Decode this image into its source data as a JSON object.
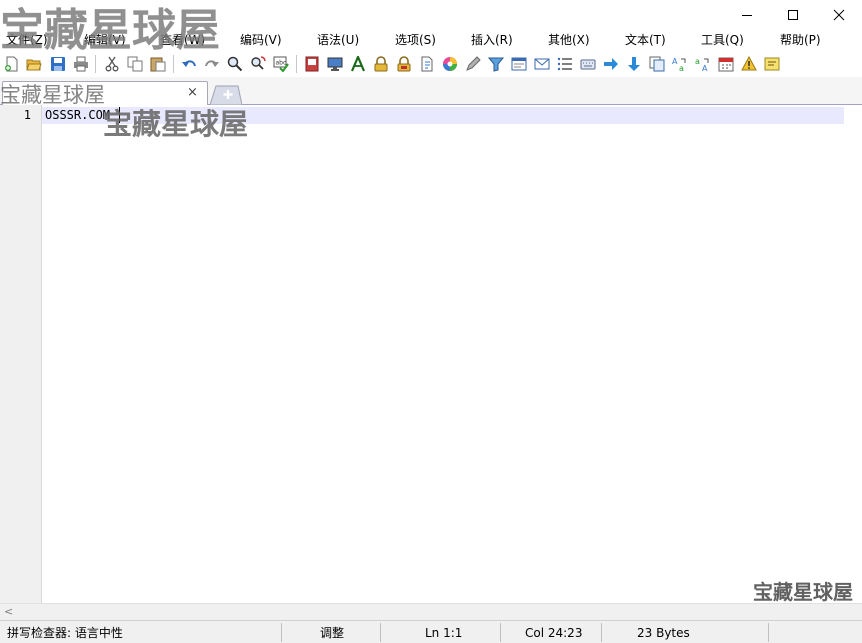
{
  "window": {
    "controls": [
      "minimize-icon",
      "maximize-icon",
      "close-icon"
    ]
  },
  "menu": {
    "items": [
      {
        "label": "文件(Z)"
      },
      {
        "label": "编辑(V)"
      },
      {
        "label": "查看(W)"
      },
      {
        "label": "编码(V)"
      },
      {
        "label": "语法(U)"
      },
      {
        "label": "选项(S)"
      },
      {
        "label": "插入(R)"
      },
      {
        "label": "其他(X)"
      },
      {
        "label": "文本(T)"
      },
      {
        "label": "工具(Q)"
      },
      {
        "label": "帮助(P)"
      }
    ]
  },
  "toolbar": {
    "icons": [
      "new-file-icon",
      "open-folder-icon",
      "save-icon",
      "print-icon",
      "cut-icon",
      "copy-icon",
      "paste-icon",
      "undo-icon",
      "redo-icon",
      "find-icon",
      "replace-icon",
      "spellcheck-icon",
      "book-icon",
      "monitor-icon",
      "font-icon",
      "lock-icon",
      "lock-read-only-icon",
      "document-export-icon",
      "color-wheel-icon",
      "pen-icon",
      "filter-icon",
      "window-icon",
      "mail-icon",
      "list-icon",
      "keyboard-icon",
      "arrow-right-icon",
      "arrow-down-icon",
      "copy-doc-icon",
      "convert-icon",
      "convert-alt-icon",
      "calendar-icon",
      "warning-icon",
      "note-icon"
    ]
  },
  "tabs": {
    "active_title": "",
    "close_symbol": "×",
    "new_tab_icon": "plus-icon"
  },
  "editor": {
    "line_number": "1",
    "line_text": "OSSSR.COM"
  },
  "statusbar": {
    "spellcheck": "拼写检查器: 语言中性",
    "mode": "调整",
    "line": "Ln 1:1",
    "column": "Col 24:23",
    "size": "23 Bytes"
  },
  "watermark": {
    "text": "宝藏星球屋"
  },
  "colors": {
    "current_line": "#e8e8ff",
    "gutter": "#f0f0f0",
    "statusbar": "#f0f0f0"
  }
}
